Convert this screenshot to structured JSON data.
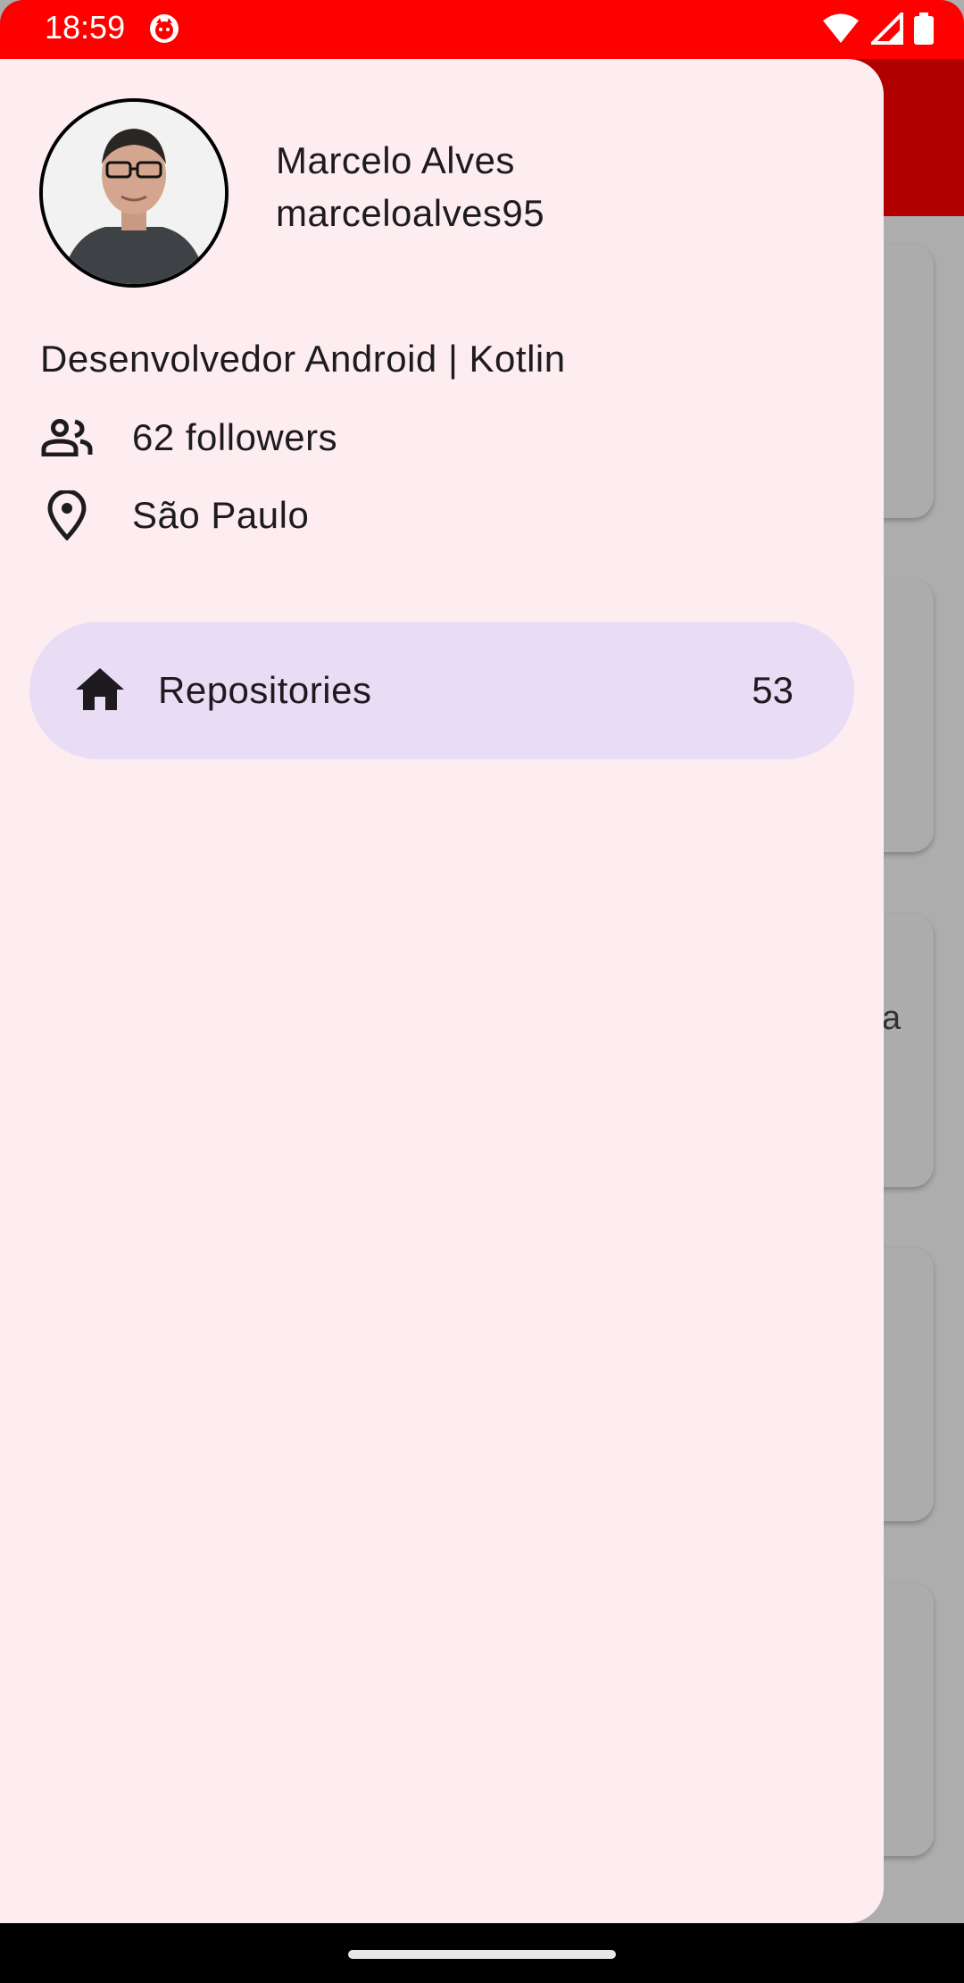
{
  "status_bar": {
    "time": "18:59",
    "app_icon": "app-notification-icon",
    "icons": [
      "wifi-icon",
      "signal-icon",
      "battery-icon"
    ],
    "color": "#ff0000"
  },
  "app": {
    "toolbar_color": "#b00000",
    "cards": [
      {
        "text": ""
      },
      {
        "text": ""
      },
      {
        "text": "a"
      },
      {
        "text": ""
      },
      {
        "text": ""
      }
    ]
  },
  "drawer": {
    "profile": {
      "name": "Marcelo Alves",
      "login": "marceloalves95",
      "bio": "Desenvolvedor Android | Kotlin",
      "followers": "62 followers",
      "location": "São Paulo",
      "avatar": "avatar-photo"
    },
    "nav_items": [
      {
        "icon": "home-icon",
        "label": "Repositories",
        "badge": "53",
        "selected": true
      }
    ],
    "background": "#fdedf0",
    "selected_color": "#e8ddf5"
  }
}
